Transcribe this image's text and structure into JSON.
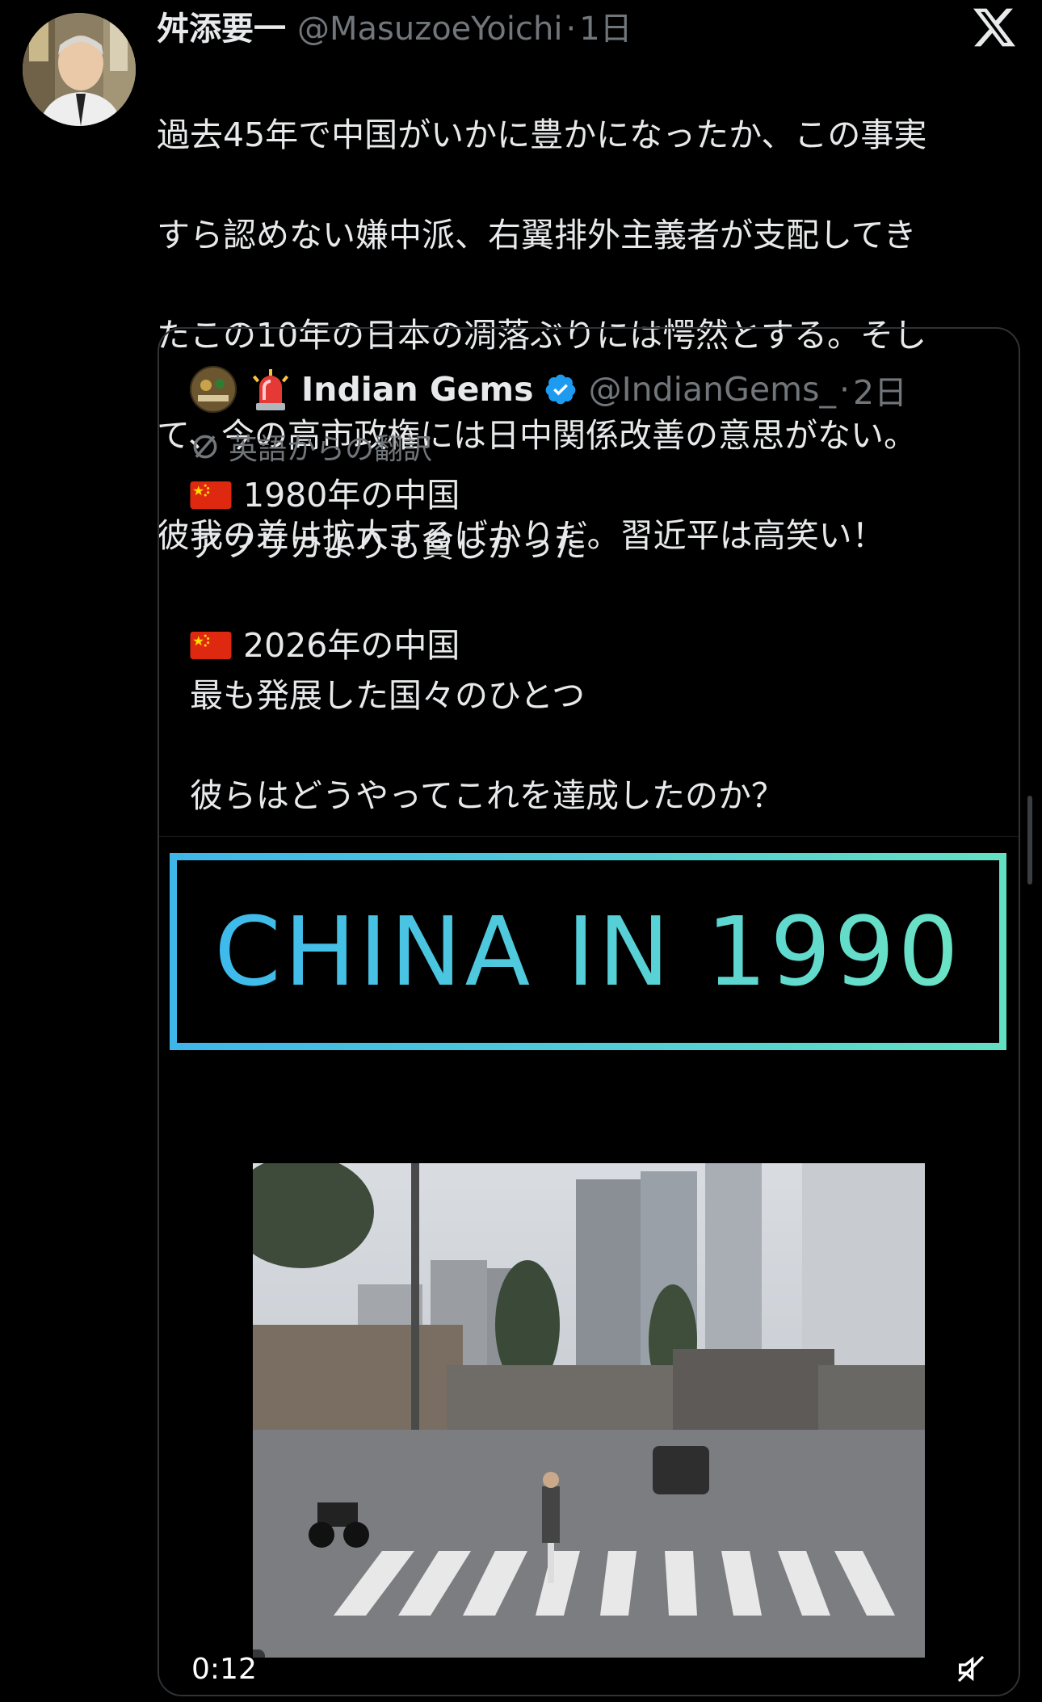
{
  "tweet": {
    "author_name": "舛添要一",
    "author_handle": "@MasuzoeYoichi",
    "separator": "·",
    "time": "1日",
    "text_lines": [
      "過去45年で中国がいかに豊かになったか、この事実",
      "すら認めない嫌中派、右翼排外主義者が支配してき",
      "たこの10年の日本の凋落ぶりには愕然とする。そし",
      "て、今の高市政権には日中関係改善の意思がない。",
      "彼我の差は拡大するばかりだ。習近平は高笑い！"
    ]
  },
  "quote": {
    "author_name": "Indian Gems",
    "author_handle": "@IndianGems_",
    "separator": "·",
    "time": "2日",
    "translation_label": "英語からの翻訳",
    "lines": {
      "l1": "1980年の中国",
      "l2": "アフリカよりも貧しかった",
      "l3": "2026年の中国",
      "l4": "最も発展した国々のひとつ",
      "l5": "彼らはどうやってこれを達成したのか？"
    },
    "media": {
      "banner_text": "CHINA IN 1990",
      "timestamp": "0:12"
    }
  },
  "colors": {
    "background": "#000000",
    "text_primary": "#e7e9ea",
    "text_secondary": "#71767b",
    "verified_blue": "#1d9bf0",
    "banner_gradient_start": "#3bb7ee",
    "banner_gradient_end": "#6de5c2"
  },
  "icons": [
    "x-logo-icon",
    "siren-emoji-icon",
    "verified-badge-icon",
    "translate-icon",
    "china-flag-icon",
    "mute-icon"
  ]
}
